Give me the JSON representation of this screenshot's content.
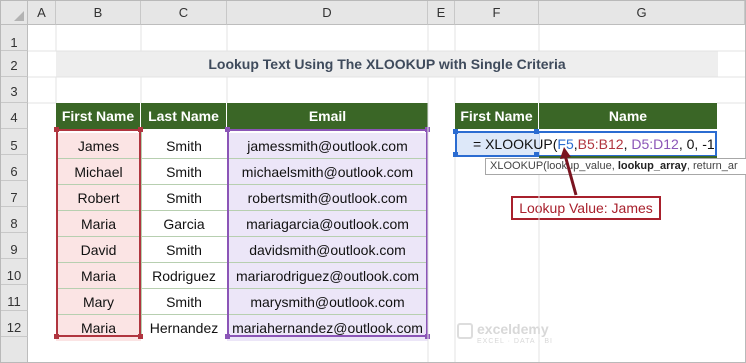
{
  "columns": [
    "A",
    "B",
    "C",
    "D",
    "E",
    "F",
    "G"
  ],
  "rows": [
    "1",
    "2",
    "3",
    "4",
    "5",
    "6",
    "7",
    "8",
    "9",
    "10",
    "11",
    "12"
  ],
  "title": "Lookup Text Using The XLOOKUP with Single Criteria",
  "table": {
    "headers": [
      "First Name",
      "Last Name",
      "Email"
    ],
    "first_names": [
      "James",
      "Michael",
      "Robert",
      "Maria",
      "David",
      "Maria",
      "Mary",
      "Maria"
    ],
    "last_names": [
      "Smith",
      "Smith",
      "Smith",
      "Garcia",
      "Smith",
      "Rodriguez",
      "Smith",
      "Hernandez"
    ],
    "emails": [
      "jamessmith@outlook.com",
      "michaelsmith@outlook.com",
      "robertsmith@outlook.com",
      "mariagarcia@outlook.com",
      "davidsmith@outlook.com",
      "mariarodriguez@outlook.com",
      "marysmith@outlook.com",
      "mariahernandez@outlook.com"
    ]
  },
  "lookup_table": {
    "headers": [
      "First Name",
      "Name"
    ]
  },
  "formula": {
    "prefix": "= XLOOKUP(",
    "arg1": "F5",
    "comma1": ",",
    "arg2": "B5:B12",
    "comma2": ", ",
    "arg3": "D5:D12",
    "suffix": ", 0, -1 )"
  },
  "tooltip": {
    "fn": "XLOOKUP(",
    "p1": "lookup_value, ",
    "p2": "lookup_array",
    "p3": ", return_ar"
  },
  "callout": "Lookup Value: James",
  "watermark": {
    "line1": "exceldemy",
    "line2": "EXCEL · DATA · BI"
  },
  "colors": {
    "header_green": "#3a6626",
    "range_red": "#b0353f",
    "range_purple": "#8b55b7",
    "active_blue": "#2b6cd1",
    "callout_red": "#a8202c"
  }
}
